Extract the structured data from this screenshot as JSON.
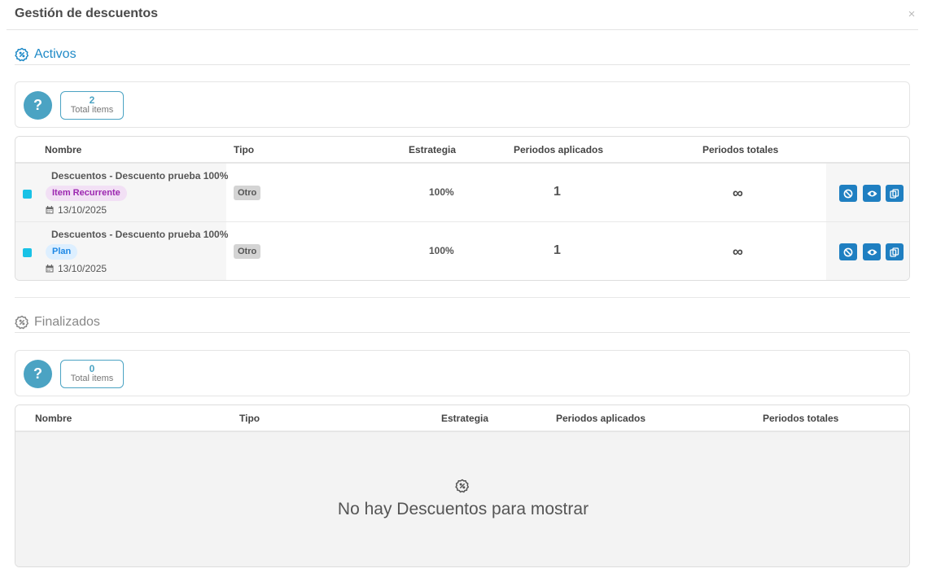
{
  "modal": {
    "title": "Gestión de descuentos",
    "close": "×"
  },
  "active": {
    "title": "Activos",
    "summary": {
      "help": "?",
      "count": "2",
      "count_label": "Total items"
    },
    "headers": {
      "nombre": "Nombre",
      "tipo": "Tipo",
      "estrategia": "Estrategia",
      "periodos_aplicados": "Periodos aplicados",
      "periodos_totales": "Periodos totales"
    },
    "rows": [
      {
        "name": "Descuentos - Descuento prueba 100%",
        "tag": "Item Recurrente",
        "date": "13/10/2025",
        "tipo": "Otro",
        "estrategia": "100%",
        "periodos_aplicados": "1",
        "periodos_totales": "∞"
      },
      {
        "name": "Descuentos - Descuento prueba 100%",
        "tag": "Plan",
        "date": "13/10/2025",
        "tipo": "Otro",
        "estrategia": "100%",
        "periodos_aplicados": "1",
        "periodos_totales": "∞"
      }
    ]
  },
  "finished": {
    "title": "Finalizados",
    "summary": {
      "help": "?",
      "count": "0",
      "count_label": "Total items"
    },
    "headers": {
      "nombre": "Nombre",
      "tipo": "Tipo",
      "estrategia": "Estrategia",
      "periodos_aplicados": "Periodos aplicados",
      "periodos_totales": "Periodos totales"
    },
    "empty_message": "No hay Descuentos para mostrar"
  },
  "colors": {
    "accent": "#1f7fc1",
    "help": "#4ba3c3",
    "checkbox": "#19c2e6",
    "tag_purple_text": "#9c27b0",
    "tag_blue_text": "#1e88e5"
  },
  "icons": {
    "section": "discount-badge-icon",
    "date": "calendar-icon",
    "actions": [
      "ban-icon",
      "eye-icon",
      "copy-icon"
    ]
  }
}
